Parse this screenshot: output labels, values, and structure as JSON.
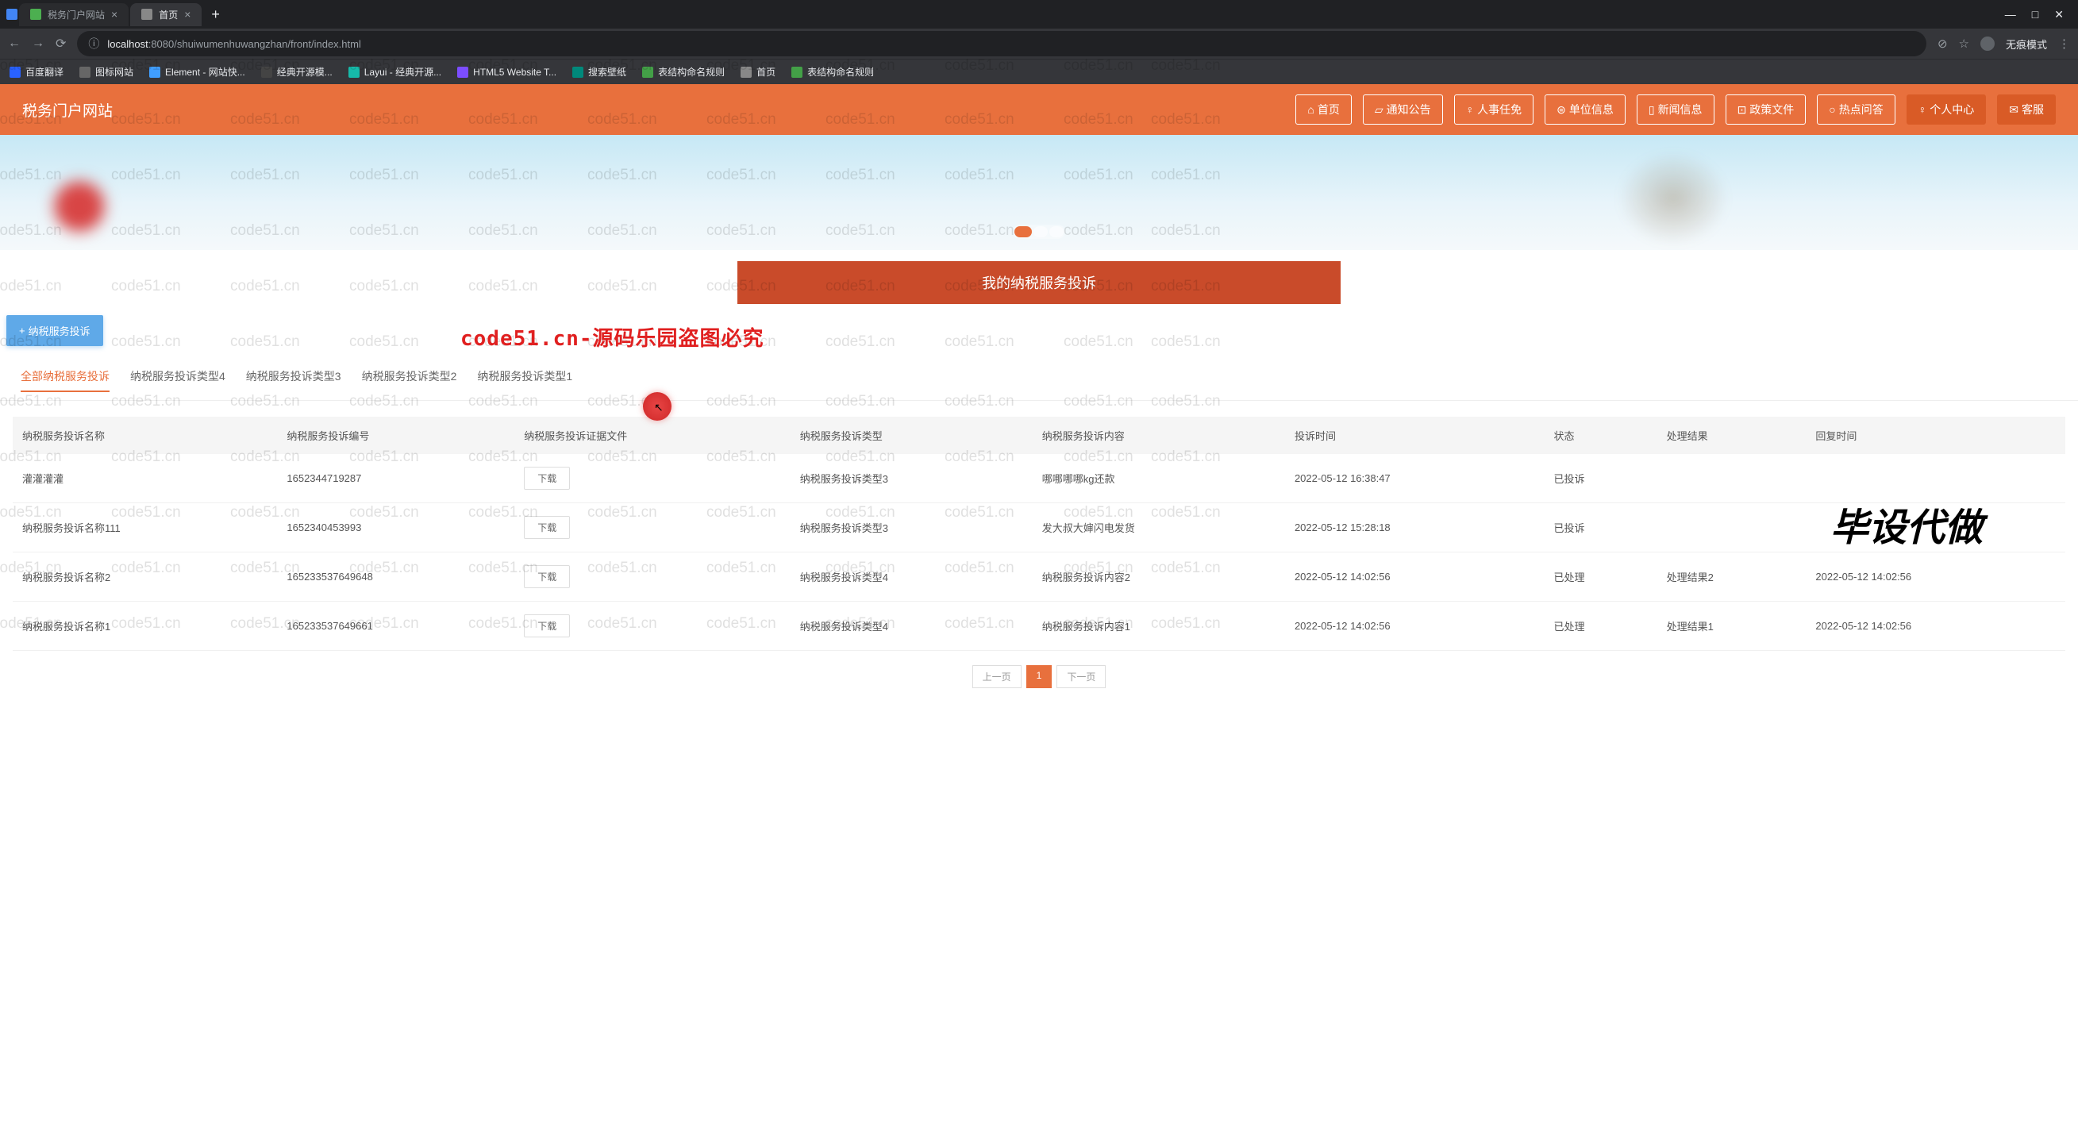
{
  "browser": {
    "tabs": [
      {
        "title": "税务门户网站",
        "active": false
      },
      {
        "title": "首页",
        "active": true
      }
    ],
    "url_host": "localhost",
    "url_port": ":8080",
    "url_path": "/shuiwumenhuwangzhan/front/index.html",
    "incognito_label": "无痕模式",
    "window": {
      "min": "—",
      "max": "□",
      "close": "✕"
    }
  },
  "bookmarks": [
    "百度翻译",
    "图标网站",
    "Element - 网站快...",
    "经典开源模...",
    "Layui - 经典开源...",
    "HTML5 Website T...",
    "搜索壁纸",
    "表结构命名规则",
    "首页",
    "表结构命名规则"
  ],
  "header": {
    "site_title": "税务门户网站",
    "nav": [
      {
        "label": "首页",
        "icon": "⌂"
      },
      {
        "label": "通知公告",
        "icon": "▱"
      },
      {
        "label": "人事任免",
        "icon": "♀"
      },
      {
        "label": "单位信息",
        "icon": "⊜"
      },
      {
        "label": "新闻信息",
        "icon": "▯"
      },
      {
        "label": "政策文件",
        "icon": "⊡"
      },
      {
        "label": "热点问答",
        "icon": "○"
      },
      {
        "label": "个人中心",
        "icon": "♀",
        "solid": true
      },
      {
        "label": "客服",
        "icon": "✉",
        "solid": true
      }
    ]
  },
  "section_title": "我的纳税服务投诉",
  "add_button": "纳税服务投诉",
  "type_tabs": [
    "全部纳税服务投诉",
    "纳税服务投诉类型4",
    "纳税服务投诉类型3",
    "纳税服务投诉类型2",
    "纳税服务投诉类型1"
  ],
  "table": {
    "headers": [
      "纳税服务投诉名称",
      "纳税服务投诉编号",
      "纳税服务投诉证据文件",
      "纳税服务投诉类型",
      "纳税服务投诉内容",
      "投诉时间",
      "状态",
      "处理结果",
      "回复时间"
    ],
    "download_label": "下载",
    "rows": [
      {
        "name": "灌灌灌灌",
        "code": "1652344719287",
        "type": "纳税服务投诉类型3",
        "content": "哪哪哪哪kg还款",
        "time": "2022-05-12 16:38:47",
        "status": "已投诉",
        "result": "",
        "reply": ""
      },
      {
        "name": "纳税服务投诉名称111",
        "code": "1652340453993",
        "type": "纳税服务投诉类型3",
        "content": "发大叔大婶闪电发货",
        "time": "2022-05-12 15:28:18",
        "status": "已投诉",
        "result": "",
        "reply": ""
      },
      {
        "name": "纳税服务投诉名称2",
        "code": "165233537649648",
        "type": "纳税服务投诉类型4",
        "content": "纳税服务投诉内容2",
        "time": "2022-05-12 14:02:56",
        "status": "已处理",
        "result": "处理结果2",
        "reply": "2022-05-12 14:02:56"
      },
      {
        "name": "纳税服务投诉名称1",
        "code": "165233537649661",
        "type": "纳税服务投诉类型4",
        "content": "纳税服务投诉内容1",
        "time": "2022-05-12 14:02:56",
        "status": "已处理",
        "result": "处理结果1",
        "reply": "2022-05-12 14:02:56"
      }
    ]
  },
  "pagination": {
    "prev": "上一页",
    "pages": [
      "1"
    ],
    "next": "下一页"
  },
  "watermark_text": "code51.cn",
  "watermark_red": "code51.cn-源码乐园盗图必究",
  "watermark_big": "毕设代做"
}
